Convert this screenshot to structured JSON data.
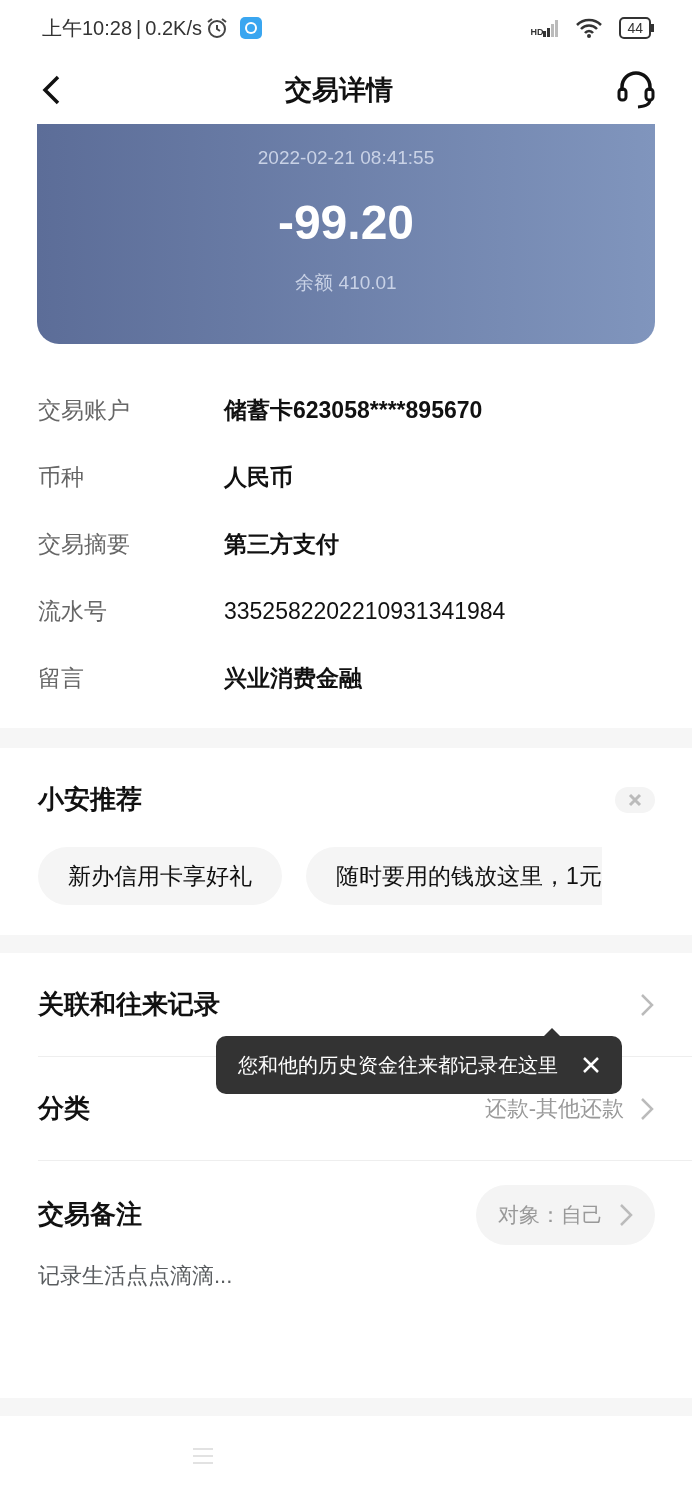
{
  "status_bar": {
    "time": "上午10:28",
    "separator": "|",
    "speed": "0.2K/s",
    "network": "HD",
    "battery": "44"
  },
  "header": {
    "title": "交易详情"
  },
  "summary": {
    "datetime": "2022-02-21 08:41:55",
    "amount": "-99.20",
    "balance": "余额 410.01"
  },
  "details": [
    {
      "label": "交易账户",
      "value": "储蓄卡623058****895670",
      "bold": true
    },
    {
      "label": "币种",
      "value": "人民币",
      "bold": true
    },
    {
      "label": "交易摘要",
      "value": "第三方支付",
      "bold": true
    },
    {
      "label": "流水号",
      "value": "3352582202210931341984",
      "bold": false
    },
    {
      "label": "留言",
      "value": "兴业消费金融",
      "bold": true
    }
  ],
  "recommend": {
    "title": "小安推荐",
    "chips": [
      "新办信用卡享好礼",
      "随时要用的钱放这里，1元"
    ]
  },
  "related": {
    "title": "关联和往来记录",
    "tooltip": "您和他的历史资金往来都记录在这里"
  },
  "category": {
    "title": "分类",
    "value": "还款-其他还款"
  },
  "note": {
    "title": "交易备注",
    "target": "对象：自己",
    "placeholder": "记录生活点点滴滴..."
  }
}
